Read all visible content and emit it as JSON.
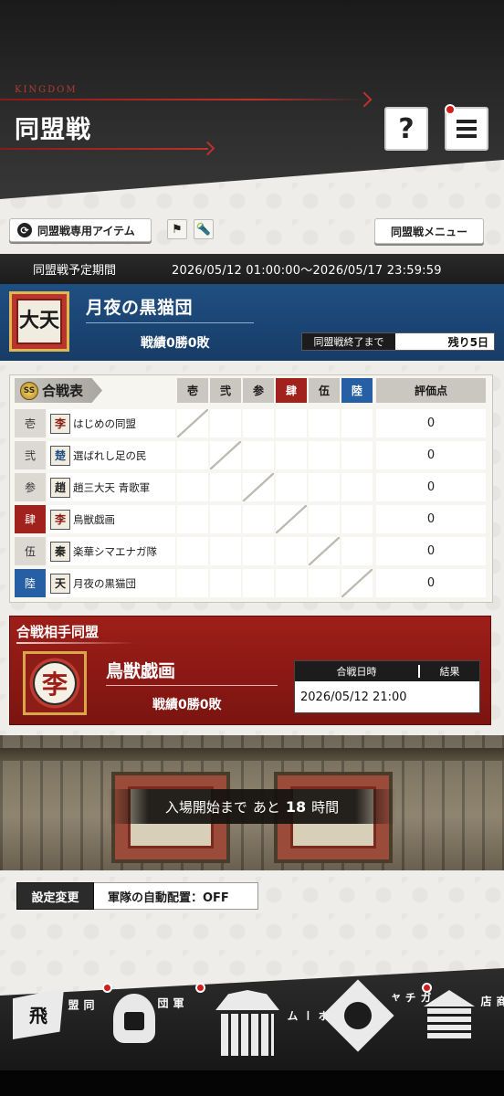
{
  "header": {
    "kingdom": "KINGDOM",
    "title": "同盟戦",
    "help_label": "?"
  },
  "toolbar": {
    "item_button": "同盟戦専用アイテム",
    "menu_button": "同盟戦メニュー"
  },
  "period": {
    "label": "同盟戦予定期間",
    "value": "2026/05/12 01:00:00～2026/05/17 23:59:59"
  },
  "alliance": {
    "emblem_text": "大天",
    "name": "月夜の黒猫団",
    "record": "戦績0勝0敗",
    "end_label": "同盟戦終了まで",
    "end_value": "残り5日"
  },
  "battle_table": {
    "badge": "SS",
    "title": "合戦表",
    "columns": [
      "壱",
      "弐",
      "参",
      "肆",
      "伍",
      "陸"
    ],
    "score_header": "評価点",
    "rows": [
      {
        "idx": "壱",
        "emblem": "李",
        "name": "はじめの同盟",
        "score": "0"
      },
      {
        "idx": "弐",
        "emblem": "楚",
        "name": "選ばれし足の民",
        "score": "0"
      },
      {
        "idx": "参",
        "emblem": "趙",
        "name": "趙三大天 青歌軍",
        "score": "0"
      },
      {
        "idx": "肆",
        "emblem": "李",
        "name": "鳥獣戯画",
        "score": "0"
      },
      {
        "idx": "伍",
        "emblem": "秦",
        "name": "楽華シマエナガ隊",
        "score": "0"
      },
      {
        "idx": "陸",
        "emblem": "天",
        "name": "月夜の黒猫団",
        "score": "0"
      }
    ]
  },
  "opponent": {
    "title": "合戦相手同盟",
    "emblem": "李",
    "name": "鳥獣戯画",
    "record": "戦績0勝0敗",
    "date_header": "合戦日時",
    "result_header": "結果",
    "date_value": "2026/05/12 21:00"
  },
  "arena": {
    "prefix": "入場開始まで",
    "mid": "あと",
    "hours": "18",
    "suffix": "時間"
  },
  "settings": {
    "tag": "設定変更",
    "value": "軍隊の自動配置：OFF"
  },
  "nav": {
    "alliance": "同盟",
    "alliance_icon": "飛",
    "army": "軍団",
    "home": "ホーム",
    "gacha": "ガチャ",
    "shop": "商店"
  },
  "colors": {
    "accent_red": "#a1221c",
    "accent_blue": "#275fa5",
    "panel_blue": "#1f4f82",
    "panel_red": "#9e1e19"
  }
}
